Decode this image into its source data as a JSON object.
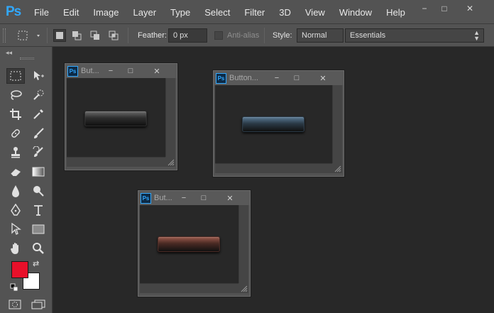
{
  "app": {
    "logo": "Ps"
  },
  "menu": [
    "File",
    "Edit",
    "Image",
    "Layer",
    "Type",
    "Select",
    "Filter",
    "3D",
    "View",
    "Window",
    "Help"
  ],
  "window_controls": {
    "minimize": "−",
    "restore": "□",
    "close": "✕"
  },
  "options_bar": {
    "feather_label": "Feather:",
    "feather_value": "0 px",
    "antialias_label": "Anti-alias",
    "style_label": "Style:",
    "style_value": "Normal",
    "workspace_value": "Essentials"
  },
  "tool_colors": {
    "foreground": "#e8102a",
    "background": "#ffffff"
  },
  "documents": [
    {
      "title": "But...",
      "button_color": "#2e2e2e",
      "accent": "#6a6a6a"
    },
    {
      "title": "Button...",
      "button_color": "#2b3a47",
      "accent": "#5a7a94"
    },
    {
      "title": "But...",
      "button_color": "#4a2a24",
      "accent": "#9a5a4c"
    }
  ]
}
